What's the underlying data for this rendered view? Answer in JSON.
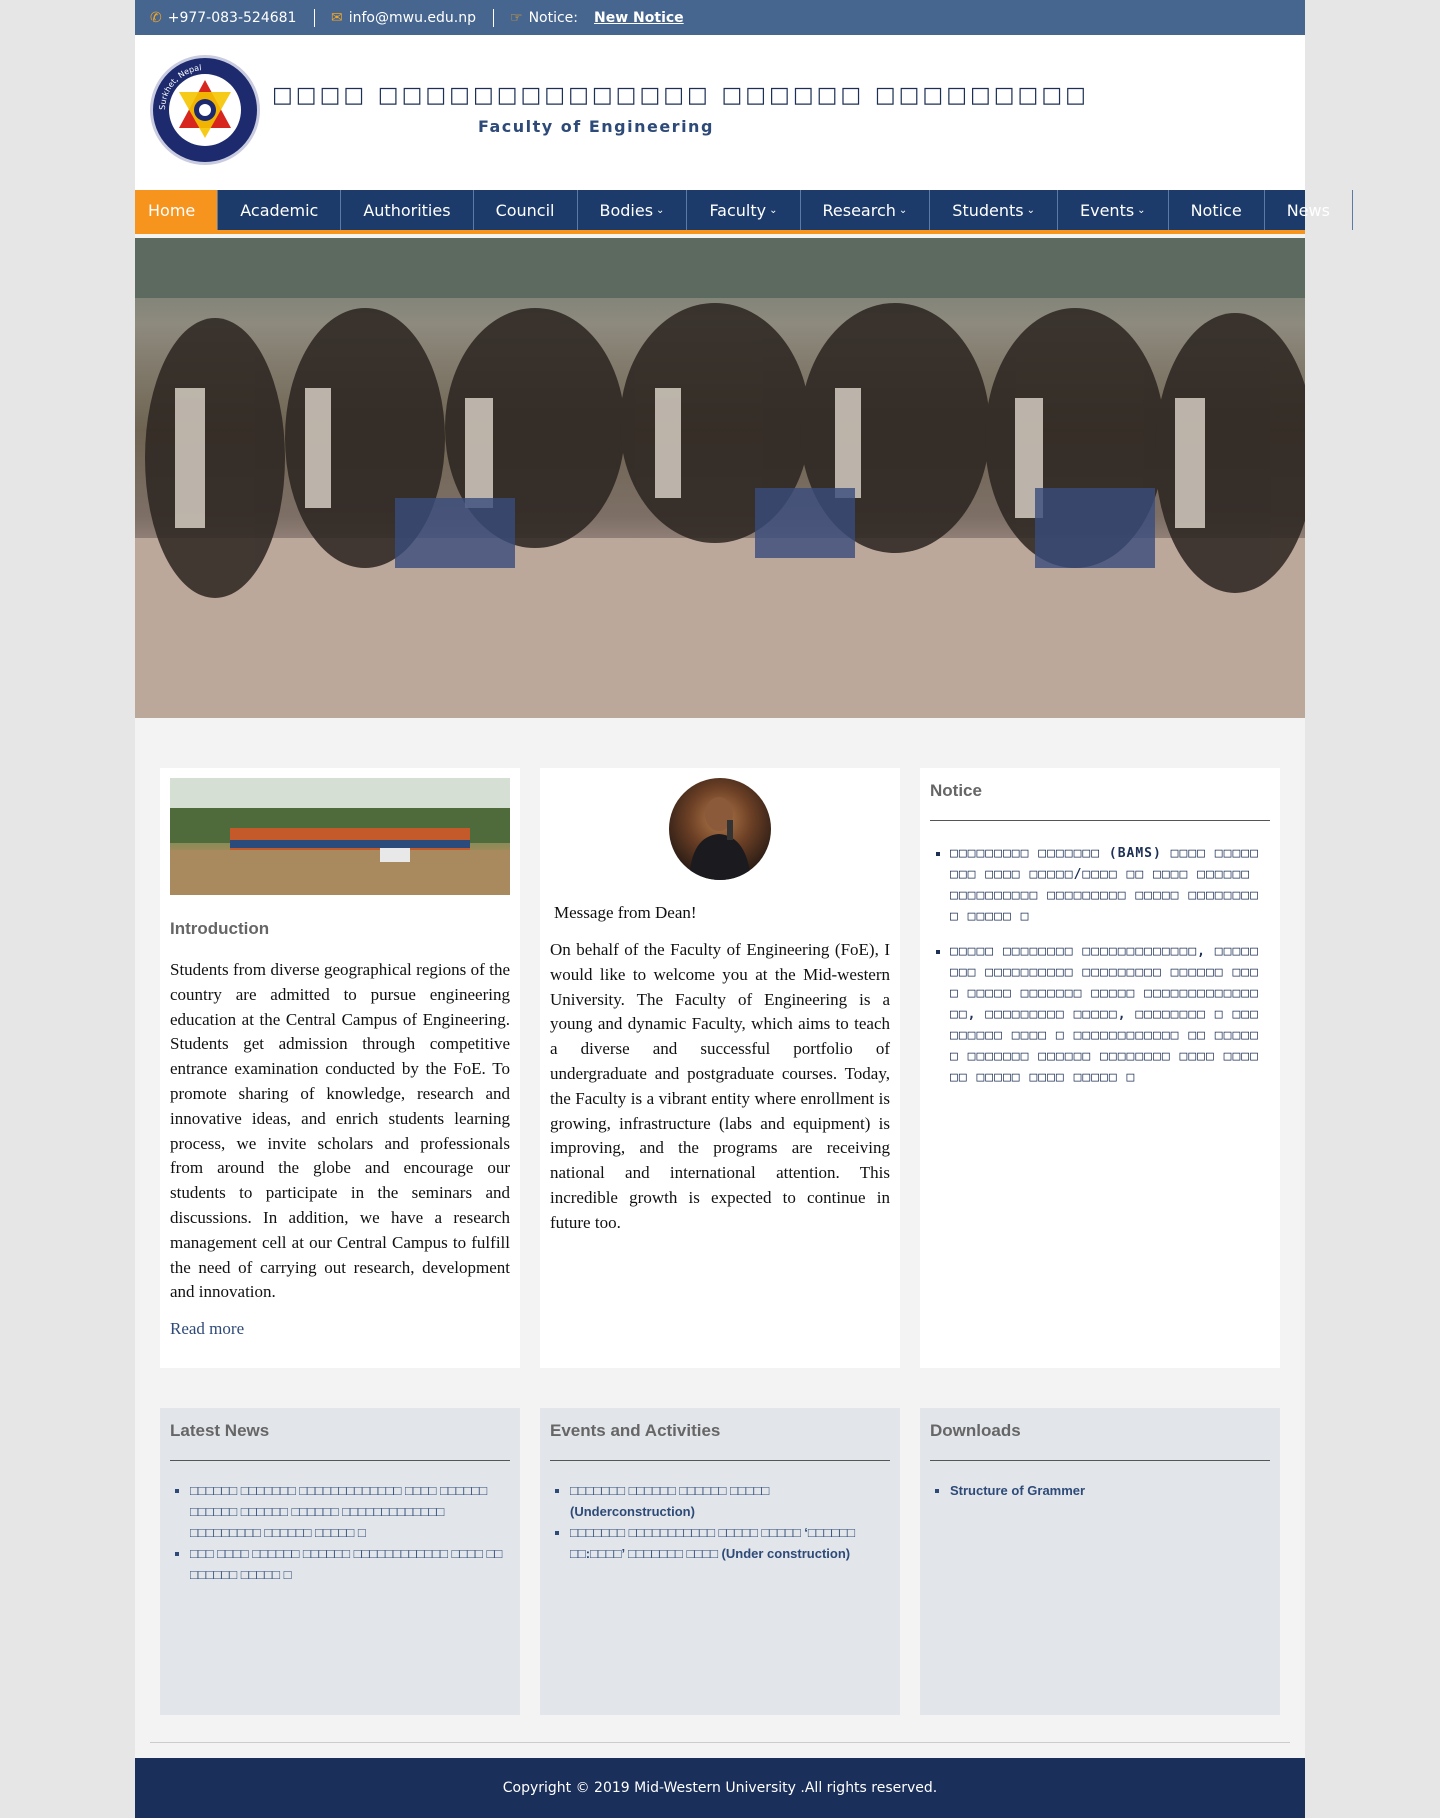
{
  "topbar": {
    "phone": "+977-083-524681",
    "email": "info@mwu.edu.np",
    "notice_label": "Notice:",
    "notice_link": "New Notice"
  },
  "header": {
    "logo_text": "Surkhet, Nepal",
    "title": "□□□□ □□□□□□□□□□□□□□ □□□□□□ □□□□□□□□□",
    "subtitle": "Faculty of Engineering"
  },
  "nav": {
    "items": [
      {
        "label": "Home",
        "active": true,
        "dropdown": false
      },
      {
        "label": "Academic",
        "dropdown": false
      },
      {
        "label": "Authorities",
        "dropdown": false
      },
      {
        "label": "Council",
        "dropdown": false
      },
      {
        "label": "Bodies",
        "dropdown": true
      },
      {
        "label": "Faculty",
        "dropdown": true
      },
      {
        "label": "Research",
        "dropdown": true
      },
      {
        "label": "Students",
        "dropdown": true
      },
      {
        "label": "Events",
        "dropdown": true
      },
      {
        "label": "Notice",
        "dropdown": false
      },
      {
        "label": "News",
        "dropdown": false
      }
    ]
  },
  "intro": {
    "heading": "Introduction",
    "body": "Students from diverse geographical regions of the country are admitted to pursue engineering education at the Central Campus of Engineering. Students get admission through competitive entrance examination conducted by the FoE. To promote sharing of knowledge, research and innovative ideas, and enrich students learning process, we invite scholars and professionals from around the globe and encourage our students to participate in the seminars and discussions. In addition, we have a research management cell at our Central Campus to fulfill the need of carrying out research, development and innovation.",
    "read_more": "Read more"
  },
  "dean": {
    "heading": "Message from Dean!",
    "body": "On behalf of the Faculty of Engineering (FoE), I would like to welcome you at the Mid-western University. The Faculty of Engineering is a young and dynamic Faculty, which aims to teach a diverse and successful portfolio of undergraduate and postgraduate courses. Today, the Faculty is a vibrant entity where enrollment is growing, infrastructure (labs and equipment) is improving, and the programs are receiving national and international attention. This incredible growth is expected to continue in future too."
  },
  "notice": {
    "heading": "Notice",
    "items": [
      "□□□□□□□□□ □□□□□□□ (BAMS) □□□□ □□□□□□□□ □□□□ □□□□□/□□□□ □□ □□□□ □□□□□□ □□□□□□□□□□ □□□□□□□□□ □□□□□ □□□□□□□□□ □□□□□ □",
      "□□□□□ □□□□□□□□ □□□□□□□□□□□□□, □□□□□□□□ □□□□□□□□□□ □□□□□□□□□ □□□□□□ □□□□ □□□□□ □□□□□□□ □□□□□ □□□□□□□□□□□□□□□, □□□□□□□□□ □□□□□, □□□□□□□□ □ □□□□□□□□□ □□□□ □ □□□□□□□□□□□□ □□ □□□□□ □ □□□□□□□ □□□□□□ □□□□□□□□ □□□□ □□□□□□ □□□□□ □□□□ □□□□□ □"
    ]
  },
  "news": {
    "heading": "Latest News",
    "items": [
      " □□□□□□ □□□□□□□ □□□□□□□□□□□□□ □□□□ □□□□□□ □□□□□□ □□□□□□ □□□□□□ □□□□□□□□□□□□□ □□□□□□□□□ □□□□□□ □□□□□ □",
      "□□□ □□□□ □□□□□□ □□□□□□ □□□□□□□□□□□□ □□□□ □□ □□□□□□ □□□□□ □"
    ]
  },
  "events": {
    "heading": "Events and Activities",
    "items": [
      "□□□□□□□ □□□□□□ □□□□□□ □□□□□ (Underconstruction)",
      "□□□□□□□ □□□□□□□□□□□ □□□□□ □□□□□ ‘□□□□□□ □□:□□□□’ □□□□□□□ □□□□ (Under construction)"
    ]
  },
  "downloads": {
    "heading": "Downloads",
    "items": [
      "Structure of Grammer"
    ]
  },
  "footer": {
    "copyright": "Copyright © 2019 Mid-Western University .All rights reserved."
  },
  "colors": {
    "topbar": "#466690",
    "nav": "#1c3b6b",
    "accent": "#f7941d",
    "footer": "#1a2f5a"
  }
}
